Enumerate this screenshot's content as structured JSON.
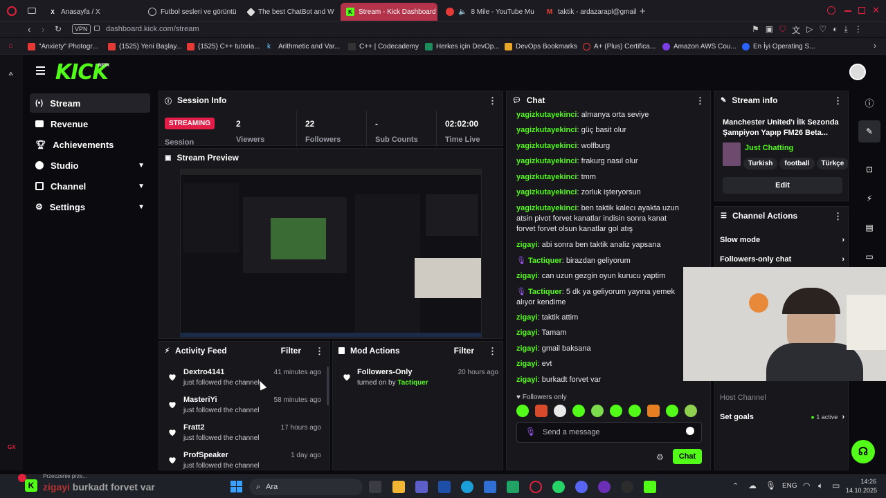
{
  "browser": {
    "tabs": [
      {
        "label": "Anasayfa / X"
      },
      {
        "label": "Futbol sesleri ve görüntü"
      },
      {
        "label": "The best ChatBot and W"
      },
      {
        "label": "Stream - Kick Dashboard"
      },
      {
        "label": "8 Mile - YouTube Mu"
      },
      {
        "label": "taktik - ardazarapl@gmail"
      }
    ],
    "vpn": "VPN",
    "url": "dashboard.kick.com/stream",
    "bookmarks": [
      "\"Anxiety\" Photogr...",
      "(1525) Yeni Başlay...",
      "(1525) C++ tutoria...",
      "Arithmetic and Var...",
      "C++ | Codecademy",
      "Herkes için DevOp...",
      "DevOps Bookmarks",
      "A+ (Plus) Certifica...",
      "Amazon AWS Cou...",
      "En İyi Operating S..."
    ]
  },
  "header": {
    "logo": "KICK",
    "beta": "BETA"
  },
  "sidebar": {
    "items": [
      {
        "label": "Stream"
      },
      {
        "label": "Revenue"
      },
      {
        "label": "Achievements"
      },
      {
        "label": "Studio"
      },
      {
        "label": "Channel"
      },
      {
        "label": "Settings"
      }
    ]
  },
  "session": {
    "title": "Session Info",
    "status_badge": "STREAMING",
    "session_label": "Session",
    "stats": [
      {
        "value": "2",
        "label": "Viewers"
      },
      {
        "value": "22",
        "label": "Followers"
      },
      {
        "value": "-",
        "label": "Sub Counts"
      },
      {
        "value": "02:02:00",
        "label": "Time Live"
      }
    ]
  },
  "preview": {
    "title": "Stream Preview"
  },
  "activity": {
    "title": "Activity Feed",
    "filter": "Filter",
    "items": [
      {
        "name": "Dextro4141",
        "sub": "just followed the channel",
        "time": "41 minutes ago"
      },
      {
        "name": "MasteriYi",
        "sub": "just followed the channel",
        "time": "58 minutes ago"
      },
      {
        "name": "Fratt2",
        "sub": "just followed the channel",
        "time": "17 hours ago"
      },
      {
        "name": "ProfSpeaker",
        "sub": "just followed the channel",
        "time": "1 day ago"
      }
    ]
  },
  "mod": {
    "title": "Mod Actions",
    "filter": "Filter",
    "items": [
      {
        "name": "Followers-Only",
        "sub": "turned on by",
        "by": "Tactiquer",
        "time": "20 hours ago"
      }
    ]
  },
  "chat": {
    "title": "Chat",
    "messages": [
      {
        "user": "yagizkutayekinci",
        "text": "almanya orta seviye"
      },
      {
        "user": "yagizkutayekinci",
        "text": "güç basit olur"
      },
      {
        "user": "yagizkutayekinci",
        "text": "wolfburg"
      },
      {
        "user": "yagizkutayekinci",
        "text": "frakurg nasıl olur"
      },
      {
        "user": "yagizkutayekinci",
        "text": "tmm"
      },
      {
        "user": "yagizkutayekinci",
        "text": "zorluk işteryorsun"
      },
      {
        "user": "yagizkutayekinci",
        "text": "ben taktik kalecı ayakta uzun atsin pivot forvet kanatlar indisin sonra kanat forvet forvet olsun kanatlar gol atış"
      },
      {
        "user": "zigayi",
        "text": "abi sonra ben taktik analiz yapsana"
      },
      {
        "user": "Tactiquer",
        "text": "birazdan geliyorum"
      },
      {
        "user": "zigayi",
        "text": "can uzun gezgin oyun kurucu yaptim"
      },
      {
        "user": "Tactiquer",
        "text": "5 dk ya geliyorum yayına yemek alıyor kendime"
      },
      {
        "user": "zigayi",
        "text": "taktik attim"
      },
      {
        "user": "zigayi",
        "text": "Tamam"
      },
      {
        "user": "zigayi",
        "text": "gmail baksana"
      },
      {
        "user": "zigayi",
        "text": "evt"
      },
      {
        "user": "zigayi",
        "text": "burkadt forvet var"
      }
    ],
    "followers_only": "Followers only",
    "placeholder": "Send a message",
    "send_label": "Chat"
  },
  "stream_info": {
    "title": "Stream info",
    "stream_title": "Manchester United'ı İlk Sezonda Şampiyon Yapıp FM26 Beta...",
    "category": "Just Chatting",
    "tags": [
      "Turkish",
      "football",
      "Türkçe"
    ],
    "edit_label": "Edit"
  },
  "channel_actions": {
    "title": "Channel Actions",
    "items": [
      {
        "label": "Slow mode"
      },
      {
        "label": "Followers-only chat"
      }
    ],
    "host_channel": "Host Channel",
    "set_goals": "Set goals",
    "goals_active": "1 active"
  },
  "overlay_chat": {
    "user": "zigayi",
    "text": "burkadt forvet var",
    "notice": "Przeczenie prze..."
  },
  "taskbar": {
    "search": "Ara",
    "lang": "ENG",
    "time": "14:26",
    "date": "14.10.2025"
  },
  "colors": {
    "kick_green": "#53fc18",
    "streaming_red": "#e11d48",
    "tab_active": "#b2334a"
  }
}
